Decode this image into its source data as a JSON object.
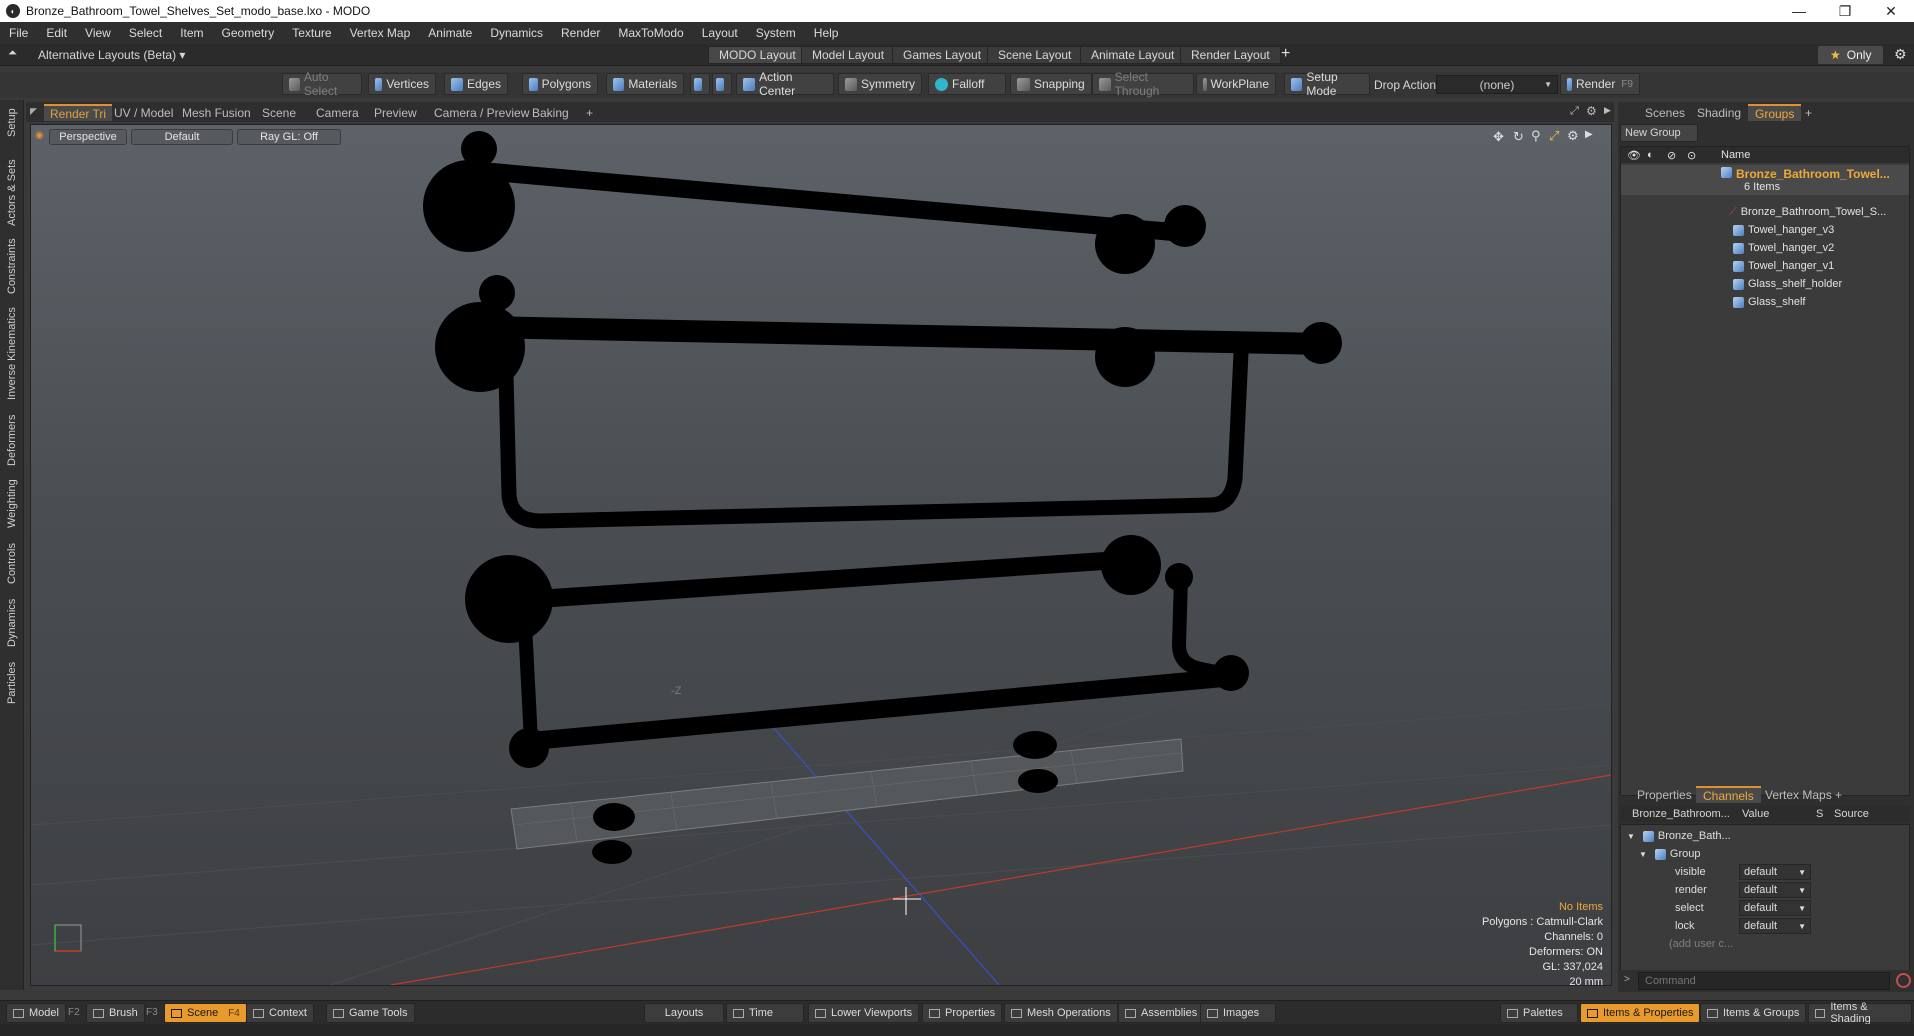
{
  "window": {
    "title": "Bronze_Bathroom_Towel_Shelves_Set_modo_base.lxo - MODO",
    "app_icon": "modo-logo-icon"
  },
  "menu": [
    "File",
    "Edit",
    "View",
    "Select",
    "Item",
    "Geometry",
    "Texture",
    "Vertex Map",
    "Animate",
    "Dynamics",
    "Render",
    "MaxToModo",
    "Layout",
    "System",
    "Help"
  ],
  "layout_bar": {
    "alt_layouts": "Alternative Layouts (Beta) ▾",
    "tabs": [
      "MODO Layout",
      "Model Layout",
      "Games Layout",
      "Scene Layout",
      "Animate Layout",
      "Render Layout"
    ],
    "add": "+",
    "only": "Only"
  },
  "toolbar": {
    "auto_select": "Auto Select",
    "vertices": "Vertices",
    "edges": "Edges",
    "polygons": "Polygons",
    "materials": "Materials",
    "action_center": "Action Center",
    "symmetry": "Symmetry",
    "falloff": "Falloff",
    "snapping": "Snapping",
    "select_through": "Select Through",
    "workplane": "WorkPlane",
    "setup_mode": "Setup Mode",
    "drop_action_label": "Drop Action",
    "drop_action_value": "(none)",
    "render": "Render",
    "render_key": "F9"
  },
  "left_tabs": [
    "Setup",
    "Actors & Sets",
    "Constraints",
    "Inverse Kinematics",
    "Deformers",
    "Weighting",
    "Controls",
    "Dynamics",
    "Particles"
  ],
  "viewport_tabs": [
    "Render Tri",
    "UV / Model",
    "Mesh Fusion",
    "Scene",
    "Camera",
    "Preview",
    "Camera / Preview",
    "Baking",
    "+"
  ],
  "viewport": {
    "view_mode": "Perspective",
    "shading": "Default",
    "raygl": "Ray GL: Off",
    "axis_label": "-Z",
    "info": {
      "selection": "No Items",
      "polygons": "Polygons : Catmull-Clark",
      "channels": "Channels: 0",
      "deformers": "Deformers: ON",
      "gl": "GL: 337,024",
      "scale": "20 mm"
    }
  },
  "right_tabs": [
    "Scenes",
    "Shading",
    "Groups",
    "+"
  ],
  "groups": {
    "new_group": "New Group",
    "name_header": "Name",
    "root": "Bronze_Bathroom_Towel...",
    "count": "6 Items",
    "items": [
      "Bronze_Bathroom_Towel_S...",
      "Towel_hanger_v3",
      "Towel_hanger_v2",
      "Towel_hanger_v1",
      "Glass_shelf_holder",
      "Glass_shelf"
    ]
  },
  "properties_tabs": [
    "Properties",
    "Channels",
    "Vertex Maps",
    "+"
  ],
  "channels": {
    "header_name": "Bronze_Bathroom...",
    "header_value": "Value",
    "header_s": "S",
    "header_source": "Source",
    "root": "Bronze_Bath...",
    "group": "Group",
    "rows": [
      {
        "name": "visible",
        "value": "default"
      },
      {
        "name": "render",
        "value": "default"
      },
      {
        "name": "select",
        "value": "default"
      },
      {
        "name": "lock",
        "value": "default"
      }
    ],
    "add": "(add user c..."
  },
  "command_placeholder": "Command",
  "bottom": {
    "left": [
      {
        "label": "Model",
        "key": "F2"
      },
      {
        "label": "Brush",
        "key": "F3"
      },
      {
        "label": "Scene",
        "key": "F4",
        "active": true
      },
      {
        "label": "Context"
      },
      {
        "label": "Game Tools"
      }
    ],
    "center": [
      "Layouts",
      "Time",
      "Lower Viewports",
      "Properties",
      "Mesh Operations",
      "Assemblies",
      "Images"
    ],
    "right": [
      {
        "label": "Palettes"
      },
      {
        "label": "Items & Properties",
        "active": true
      },
      {
        "label": "Items & Groups"
      },
      {
        "label": "Items & Shading"
      }
    ]
  },
  "colors": {
    "accent": "#e89a2c",
    "viewport_top": "#5c6268",
    "viewport_bottom": "#3d3f42"
  }
}
